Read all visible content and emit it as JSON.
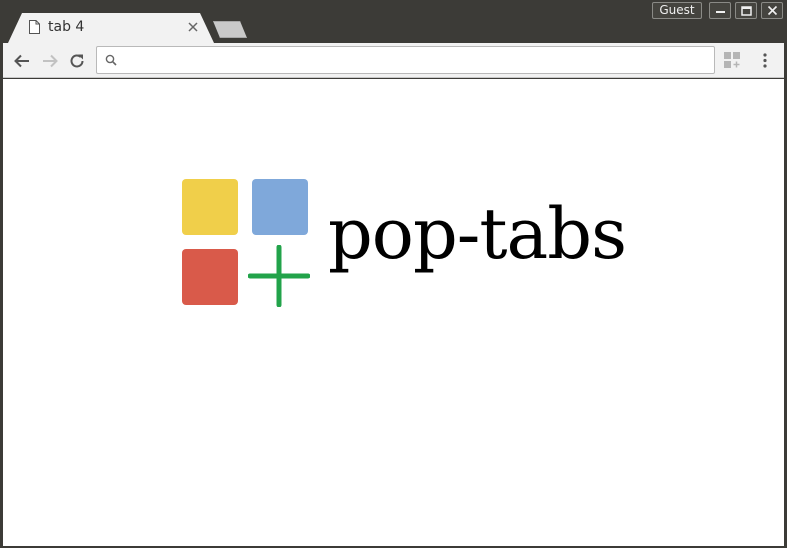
{
  "tab": {
    "title": "tab 4",
    "favicon": "document-icon"
  },
  "window": {
    "guest_label": "Guest"
  },
  "toolbar": {
    "address_value": "",
    "address_placeholder": ""
  },
  "page": {
    "logo_text": "pop-tabs",
    "logo_colors": {
      "yellow": "#f0cf4a",
      "blue": "#7fa8da",
      "red": "#d95a4a",
      "green": "#22a34a"
    }
  }
}
